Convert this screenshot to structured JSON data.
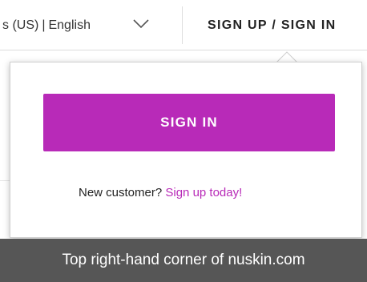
{
  "header": {
    "region_text": "s (US)",
    "separator": "|",
    "language": "English",
    "chevron_icon": "chevron-down-icon",
    "account_link": "SIGN UP / SIGN IN"
  },
  "popup": {
    "signin_button_label": "SIGN IN",
    "new_customer_text": "New customer?",
    "signup_link_text": "Sign up today!"
  },
  "caption": {
    "text": "Top right-hand corner of nuskin.com"
  },
  "colors": {
    "accent": "#b82ab8",
    "caption_bg": "#565656",
    "text": "#222222"
  }
}
